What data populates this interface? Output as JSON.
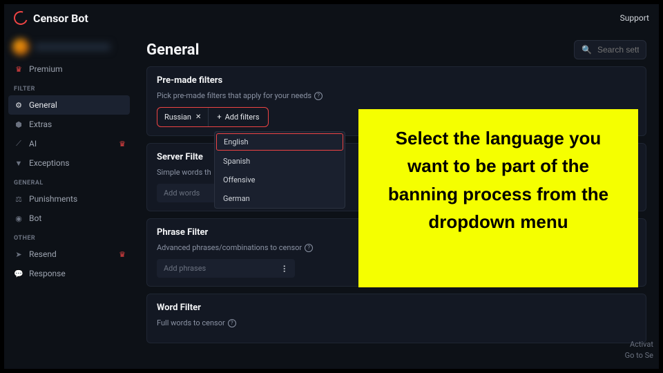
{
  "brand": {
    "name": "Censor Bot"
  },
  "topbar": {
    "support": "Support"
  },
  "sidebar": {
    "premium": "Premium",
    "headings": {
      "filter": "FILTER",
      "general": "GENERAL",
      "other": "OTHER"
    },
    "items": {
      "general": "General",
      "extras": "Extras",
      "ai": "AI",
      "exceptions": "Exceptions",
      "punishments": "Punishments",
      "bot": "Bot",
      "resend": "Resend",
      "response": "Response"
    }
  },
  "search": {
    "placeholder": "Search sett"
  },
  "page": {
    "title": "General"
  },
  "premade": {
    "title": "Pre-made filters",
    "subtitle": "Pick pre-made filters that apply for your needs",
    "chip": "Russian",
    "add": "Add filters",
    "options": [
      "English",
      "Spanish",
      "Offensive",
      "German"
    ]
  },
  "server": {
    "title": "Server Filte",
    "subtitle": "Simple words th",
    "placeholder": "Add words"
  },
  "phrase": {
    "title": "Phrase Filter",
    "subtitle": "Advanced phrases/combinations to censor",
    "placeholder": "Add phrases"
  },
  "word": {
    "title": "Word Filter",
    "subtitle": "Full words to censor"
  },
  "callout": "Select the language you want to be part of the banning process from the dropdown menu",
  "activate": {
    "l1": "Activat",
    "l2": "Go to Se"
  }
}
